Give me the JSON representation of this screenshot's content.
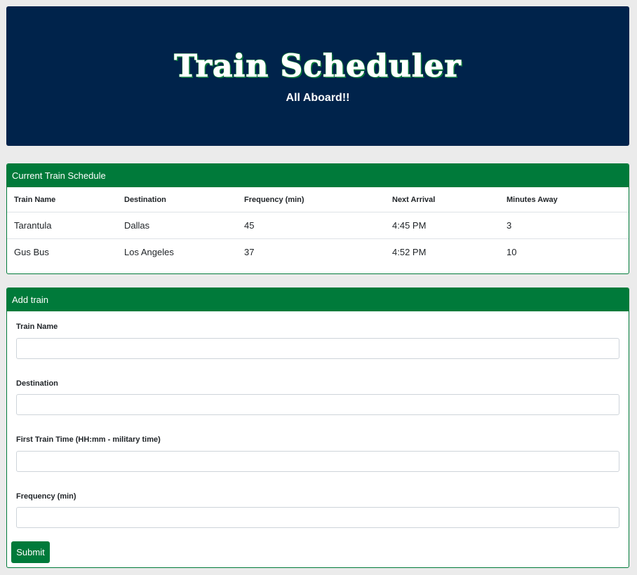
{
  "header": {
    "title": "Train Scheduler",
    "subtitle": "All Aboard!!"
  },
  "schedule": {
    "heading": "Current Train Schedule",
    "columns": [
      "Train Name",
      "Destination",
      "Frequency (min)",
      "Next Arrival",
      "Minutes Away"
    ],
    "rows": [
      [
        "Tarantula",
        "Dallas",
        "45",
        "4:45 PM",
        "3"
      ],
      [
        "Gus Bus",
        "Los Angeles",
        "37",
        "4:52 PM",
        "10"
      ]
    ]
  },
  "add_train": {
    "heading": "Add train",
    "fields": [
      {
        "label": "Train Name",
        "value": "",
        "placeholder": ""
      },
      {
        "label": "Destination",
        "value": "",
        "placeholder": ""
      },
      {
        "label": "First Train Time (HH:mm - military time)",
        "value": "",
        "placeholder": ""
      },
      {
        "label": "Frequency (min)",
        "value": "",
        "placeholder": ""
      }
    ],
    "submit_label": "Submit"
  },
  "colors": {
    "jumbotron_bg": "#00234b",
    "accent_green": "#007a3a",
    "page_bg": "#ebebeb"
  }
}
